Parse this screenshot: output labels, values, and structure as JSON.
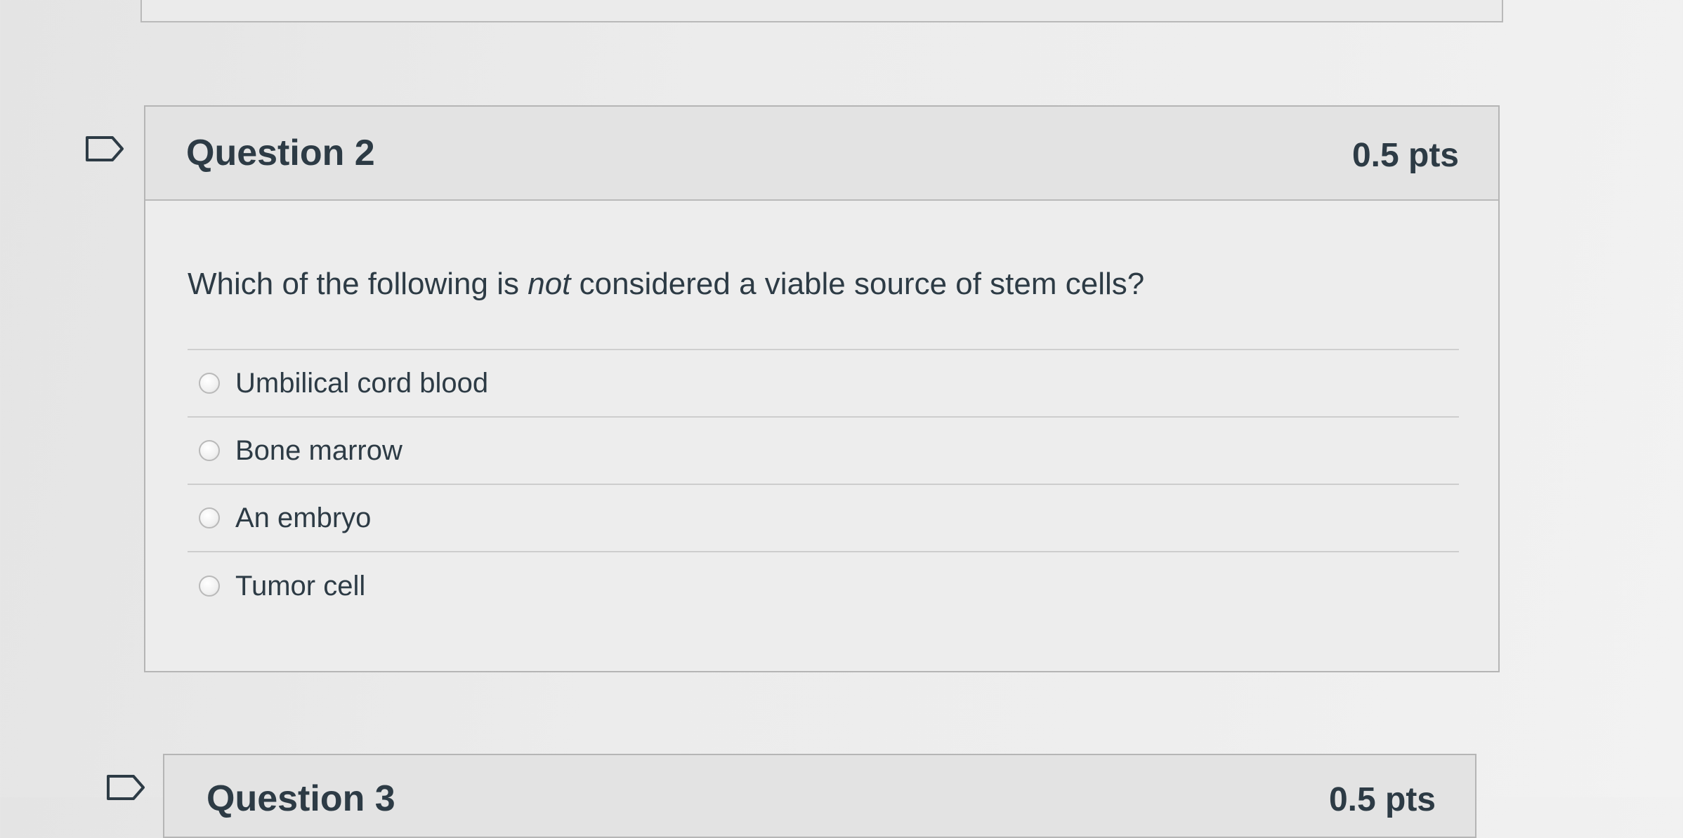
{
  "question": {
    "title": "Question 2",
    "points": "0.5 pts",
    "text_before": "Which of the following is ",
    "text_emphasis": "not",
    "text_after": " considered a viable source of stem cells?",
    "answers": [
      {
        "label": "Umbilical cord blood",
        "selected": false
      },
      {
        "label": "Bone marrow",
        "selected": false
      },
      {
        "label": "An embryo",
        "selected": false
      },
      {
        "label": "Tumor cell",
        "selected": false
      }
    ]
  },
  "next_question": {
    "title": "Question 3",
    "points": "0.5 pts"
  },
  "icons": {
    "flag": "flag-icon",
    "radio": "radio-unselected-icon"
  }
}
